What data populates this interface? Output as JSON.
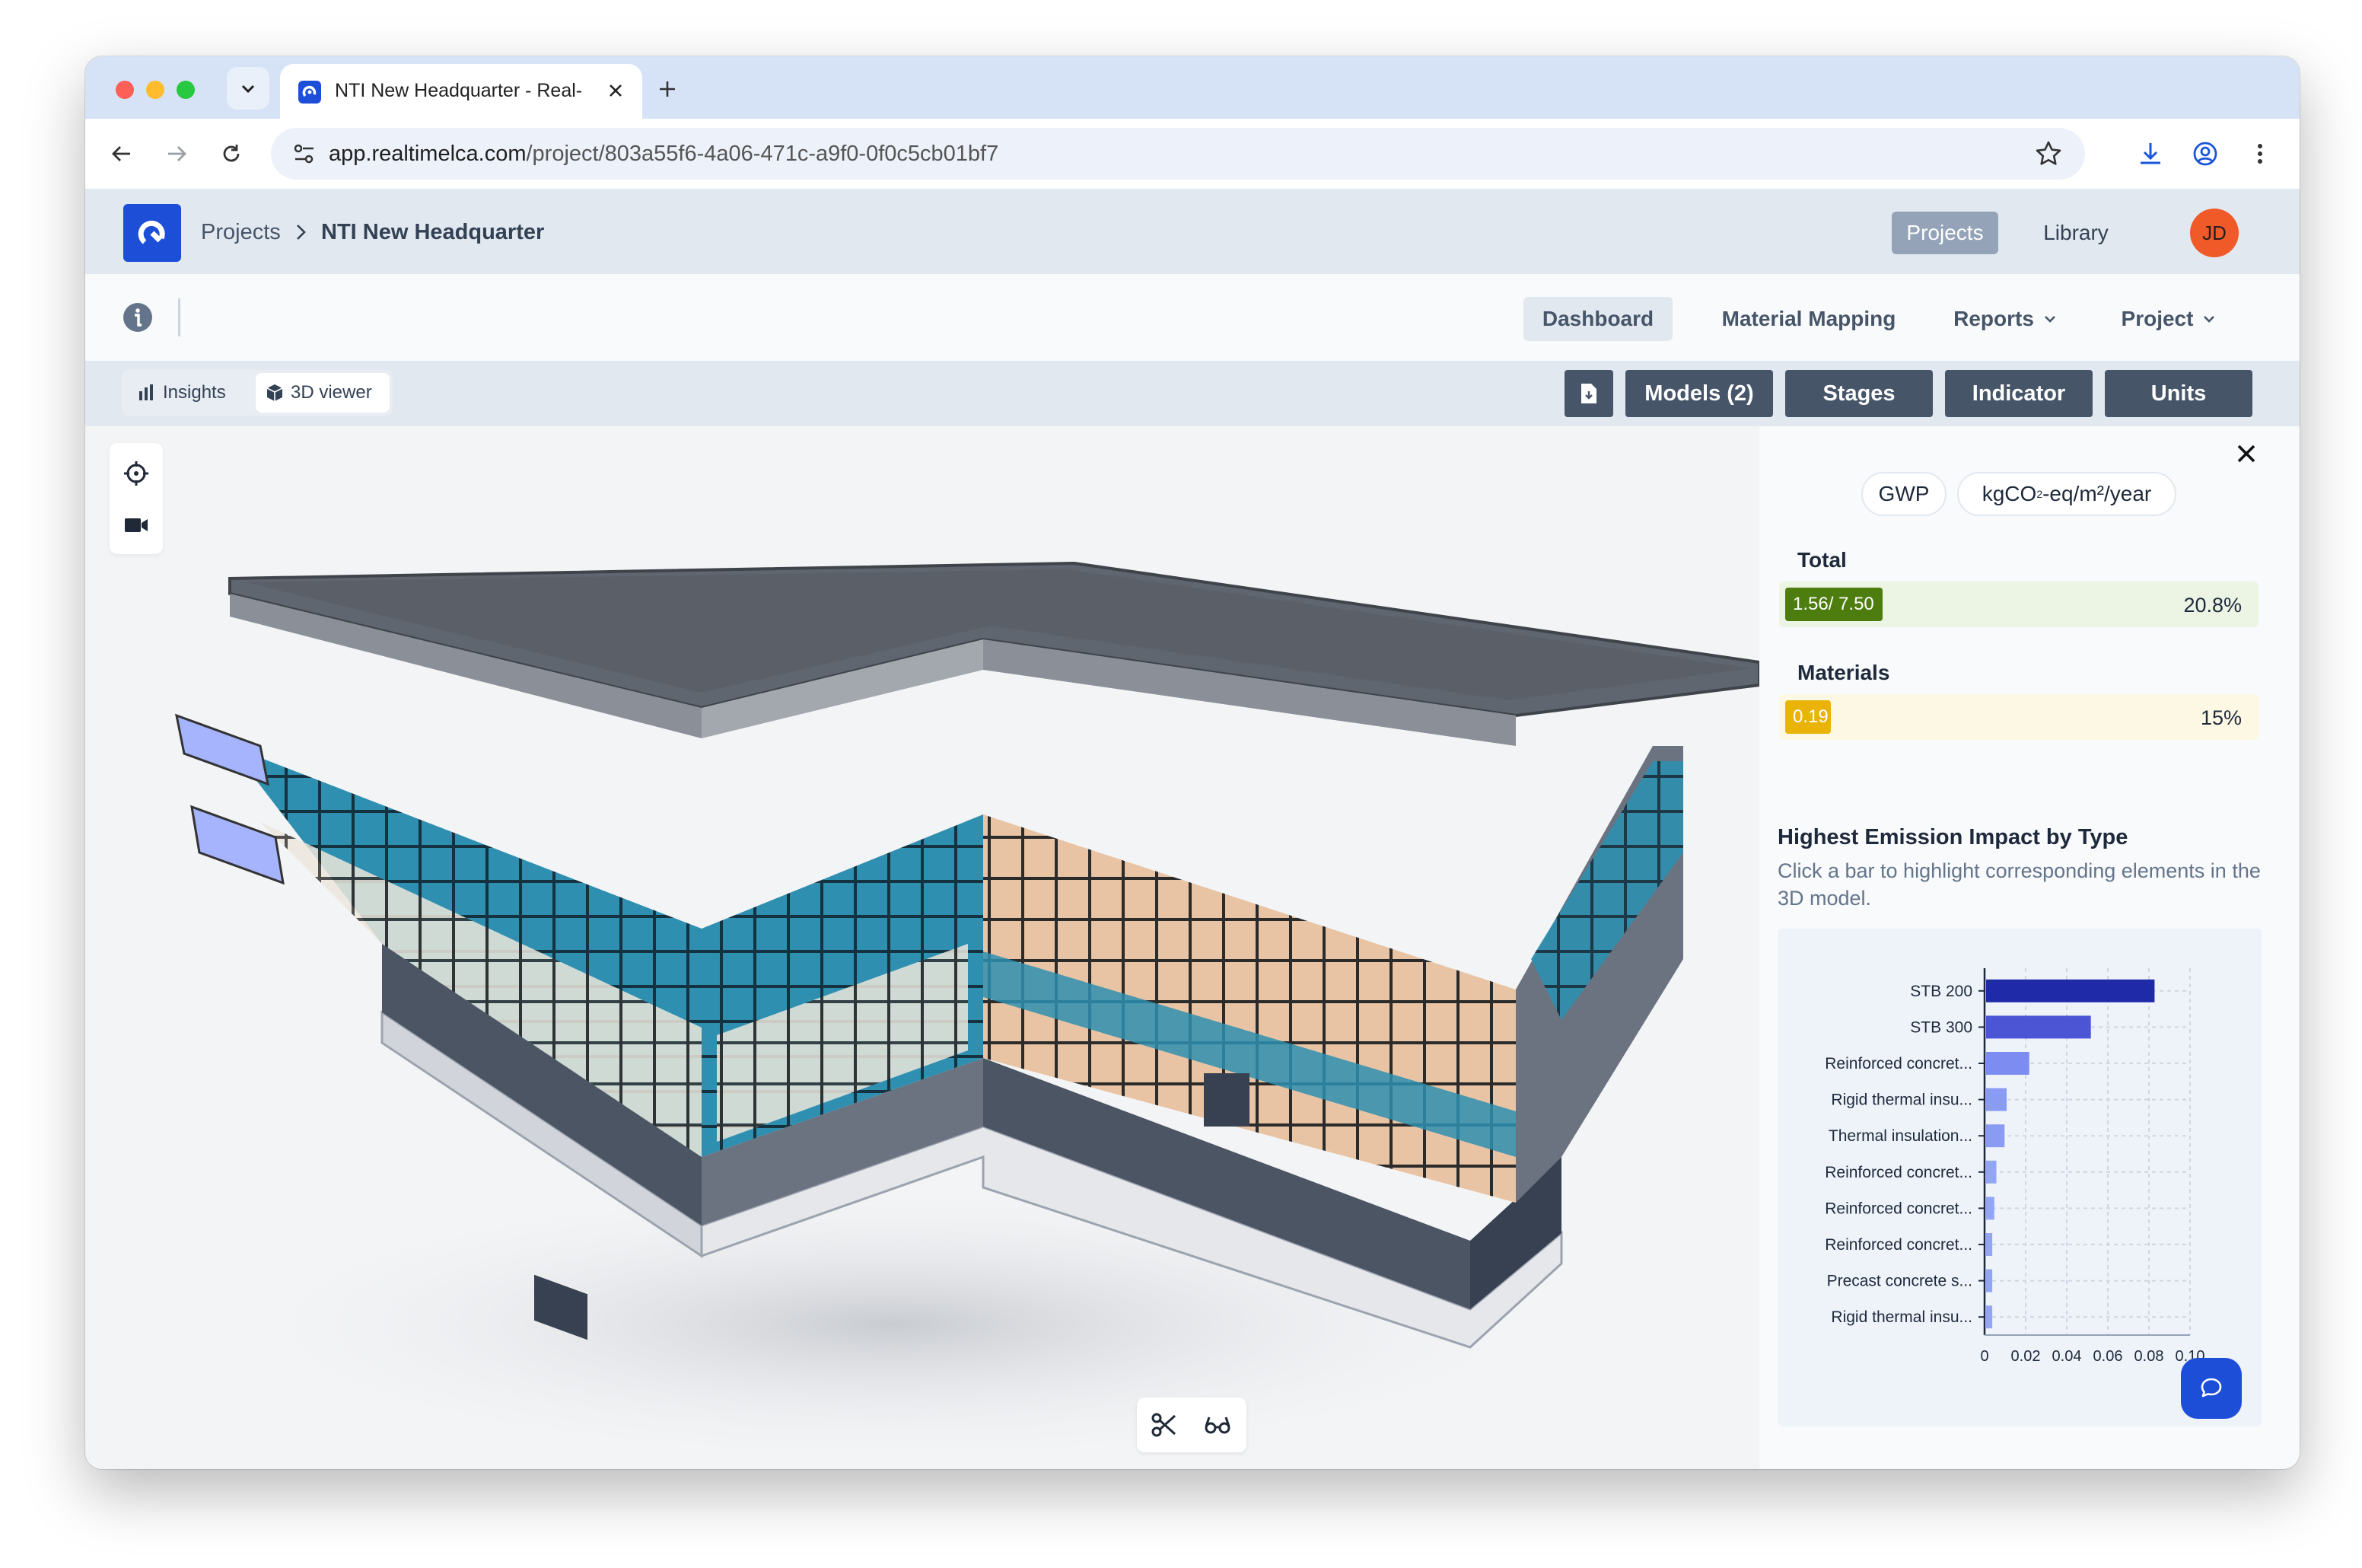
{
  "browser": {
    "tab_title": "NTI New Headquarter - Real-",
    "url_host": "app.realtimelca.com",
    "url_path": "/project/803a55f6-4a06-471c-a9f0-0f0c5cb01bf7"
  },
  "header": {
    "breadcrumb_root": "Projects",
    "breadcrumb_current": "NTI New Headquarter",
    "nav_projects": "Projects",
    "nav_library": "Library",
    "avatar_initials": "JD"
  },
  "nav": {
    "dashboard": "Dashboard",
    "material_mapping": "Material Mapping",
    "reports": "Reports",
    "project": "Project"
  },
  "subbar": {
    "insights": "Insights",
    "viewer": "3D viewer",
    "models": "Models (2)",
    "stages": "Stages",
    "indicator": "Indicator",
    "units": "Units"
  },
  "panel": {
    "indicator_pill": "GWP",
    "unit_pill": {
      "prefix": "kgCO",
      "sub": "2",
      "suffix": "-eq/m²/year"
    },
    "total_label": "Total",
    "total_value": "1.56/ 7.50",
    "total_fraction": 0.208,
    "total_percent": "20.8%",
    "materials_label": "Materials",
    "materials_value": "0.19",
    "materials_fraction": 0.15,
    "materials_percent": "15%",
    "chart_title": "Highest Emission Impact by Type",
    "chart_description": "Click a bar to highlight corresponding elements in the 3D model.",
    "colors": {
      "total_bar": "#4d7c0f",
      "total_bg": "#ecf5e4",
      "materials_bar": "#eab308",
      "materials_bg": "#fdf8e4"
    }
  },
  "chart_data": {
    "type": "bar",
    "orientation": "horizontal",
    "categories": [
      "STB 200",
      "STB 300",
      "Reinforced concret...",
      "Rigid thermal insu...",
      "Thermal insulation...",
      "Reinforced concret...",
      "Reinforced concret...",
      "Reinforced concret...",
      "Precast concrete s...",
      "Rigid thermal insu..."
    ],
    "values": [
      0.082,
      0.051,
      0.021,
      0.01,
      0.009,
      0.005,
      0.004,
      0.003,
      0.003,
      0.003
    ],
    "colors": [
      "#1e2aa8",
      "#4c56d4",
      "#7d8cf0",
      "#8a9bf4",
      "#8a9bf4",
      "#93a5f6",
      "#93a5f6",
      "#93a5f6",
      "#93a5f6",
      "#93a5f6"
    ],
    "xticks": [
      "0",
      "0.02",
      "0.04",
      "0.06",
      "0.08",
      "0.10"
    ],
    "xlim": [
      0,
      0.1
    ],
    "grid": true
  }
}
